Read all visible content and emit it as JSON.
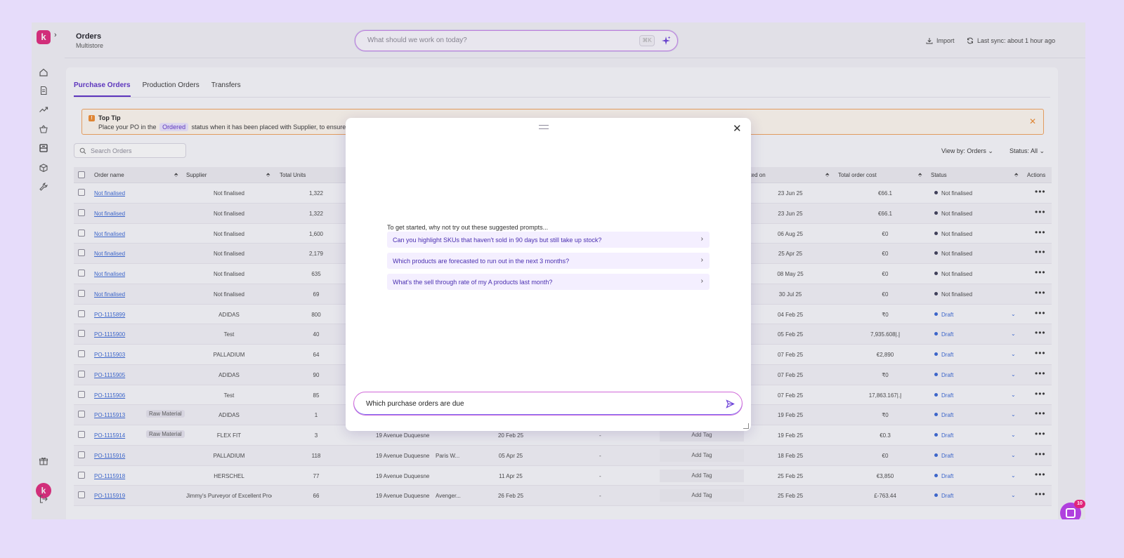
{
  "header": {
    "title": "Orders",
    "subtitle": "Multistore",
    "command_placeholder": "What should we work on today?",
    "shortcut": "⌘K",
    "import_label": "Import",
    "sync_label": "Last sync: about 1 hour ago"
  },
  "brand": {
    "logo_letter": "k",
    "accent": "#e0257a",
    "primary": "#5b2ec7"
  },
  "tabs": [
    {
      "label": "Purchase Orders",
      "active": true
    },
    {
      "label": "Production Orders",
      "active": false
    },
    {
      "label": "Transfers",
      "active": false
    }
  ],
  "tip": {
    "title": "Top Tip",
    "before": "Place your PO in the",
    "badge": "Ordered",
    "after": "status when it has been placed with Supplier, to ensure yo"
  },
  "search": {
    "placeholder": "Search Orders"
  },
  "filters": {
    "view_by": "View by: Orders",
    "status": "Status: All"
  },
  "table": {
    "columns": [
      "Order name",
      "Supplier",
      "Total Units",
      "ated on",
      "Total order cost",
      "Status",
      "Actions"
    ],
    "rows": [
      {
        "name": "Not finalised",
        "tag": "",
        "supplier": "Not finalised",
        "units": "1,322",
        "address": "",
        "date": "",
        "extra": "",
        "dash": "",
        "addtag": "",
        "created": "23 Jun 25",
        "cost": "€66.1",
        "status": "Not finalised"
      },
      {
        "name": "Not finalised",
        "tag": "",
        "supplier": "Not finalised",
        "units": "1,322",
        "address": "",
        "date": "",
        "extra": "",
        "dash": "",
        "addtag": "",
        "created": "23 Jun 25",
        "cost": "€66.1",
        "status": "Not finalised"
      },
      {
        "name": "Not finalised",
        "tag": "",
        "supplier": "Not finalised",
        "units": "1,600",
        "address": "",
        "date": "",
        "extra": "",
        "dash": "",
        "addtag": "",
        "created": "06 Aug 25",
        "cost": "€0",
        "status": "Not finalised"
      },
      {
        "name": "Not finalised",
        "tag": "",
        "supplier": "Not finalised",
        "units": "2,179",
        "address": "",
        "date": "",
        "extra": "",
        "dash": "",
        "addtag": "",
        "created": "25 Apr 25",
        "cost": "€0",
        "status": "Not finalised"
      },
      {
        "name": "Not finalised",
        "tag": "",
        "supplier": "Not finalised",
        "units": "635",
        "address": "",
        "date": "",
        "extra": "",
        "dash": "",
        "addtag": "",
        "created": "08 May 25",
        "cost": "€0",
        "status": "Not finalised"
      },
      {
        "name": "Not finalised",
        "tag": "",
        "supplier": "Not finalised",
        "units": "69",
        "address": "",
        "date": "",
        "extra": "",
        "dash": "",
        "addtag": "",
        "created": "30 Jul 25",
        "cost": "€0",
        "status": "Not finalised"
      },
      {
        "name": "PO-1115899",
        "tag": "",
        "supplier": "ADIDAS",
        "units": "800",
        "address": "",
        "date": "",
        "extra": "",
        "dash": "",
        "addtag": "",
        "created": "04 Feb 25",
        "cost": "₹0",
        "status": "Draft"
      },
      {
        "name": "PO-1115900",
        "tag": "",
        "supplier": "Test",
        "units": "40",
        "address": "",
        "date": "",
        "extra": "",
        "dash": "",
        "addtag": "",
        "created": "05 Feb 25",
        "cost": "7,935.608|.إ",
        "status": "Draft"
      },
      {
        "name": "PO-1115903",
        "tag": "",
        "supplier": "PALLADIUM",
        "units": "64",
        "address": "",
        "date": "",
        "extra": "",
        "dash": "",
        "addtag": "",
        "created": "07 Feb 25",
        "cost": "€2,890",
        "status": "Draft"
      },
      {
        "name": "PO-1115905",
        "tag": "",
        "supplier": "ADIDAS",
        "units": "90",
        "address": "",
        "date": "",
        "extra": "",
        "dash": "",
        "addtag": "",
        "created": "07 Feb 25",
        "cost": "₹0",
        "status": "Draft"
      },
      {
        "name": "PO-1115906",
        "tag": "",
        "supplier": "Test",
        "units": "85",
        "address": "",
        "date": "",
        "extra": "",
        "dash": "",
        "addtag": "",
        "created": "07 Feb 25",
        "cost": "17,863.167|.إ",
        "status": "Draft"
      },
      {
        "name": "PO-1115913",
        "tag": "Raw Material",
        "supplier": "ADIDAS",
        "units": "1",
        "address": "",
        "date": "",
        "extra": "",
        "dash": "",
        "addtag": "",
        "created": "19 Feb 25",
        "cost": "₹0",
        "status": "Draft"
      },
      {
        "name": "PO-1115914",
        "tag": "Raw Material",
        "supplier": "FLEX FIT",
        "units": "3",
        "address": "19 Avenue Duquesne",
        "date": "20 Feb 25",
        "extra": "",
        "dash": "-",
        "addtag": "Add Tag",
        "created": "19 Feb 25",
        "cost": "€0.3",
        "status": "Draft"
      },
      {
        "name": "PO-1115916",
        "tag": "",
        "supplier": "PALLADIUM",
        "units": "118",
        "address": "19 Avenue Duquesne",
        "date": "05 Apr 25",
        "extra": "Paris W...",
        "dash": "-",
        "addtag": "Add Tag",
        "created": "18 Feb 25",
        "cost": "€0",
        "status": "Draft"
      },
      {
        "name": "PO-1115918",
        "tag": "",
        "supplier": "HERSCHEL",
        "units": "77",
        "address": "19 Avenue Duquesne",
        "date": "11 Apr 25",
        "extra": "",
        "dash": "-",
        "addtag": "Add Tag",
        "created": "25 Feb 25",
        "cost": "€3,850",
        "status": "Draft"
      },
      {
        "name": "PO-1115919",
        "tag": "",
        "supplier": "Jimmy's Purveyor of Excellent Prod...",
        "units": "66",
        "address": "19 Avenue Duquesne",
        "date": "26 Feb 25",
        "extra": "Avenger...",
        "dash": "-",
        "addtag": "Add Tag",
        "created": "25 Feb 25",
        "cost": "£-763.44",
        "status": "Draft"
      }
    ]
  },
  "modal": {
    "intro": "To get started, why not try out these suggested prompts...",
    "prompts": [
      "Can you highlight SKUs that haven't sold in 90 days but still take up stock?",
      "Which products are forecasted to run out in the next 3 months?",
      "What's the sell through rate of my A products last month?"
    ],
    "input_value": "Which purchase orders are due"
  },
  "chat_widget": {
    "badge": "10"
  }
}
